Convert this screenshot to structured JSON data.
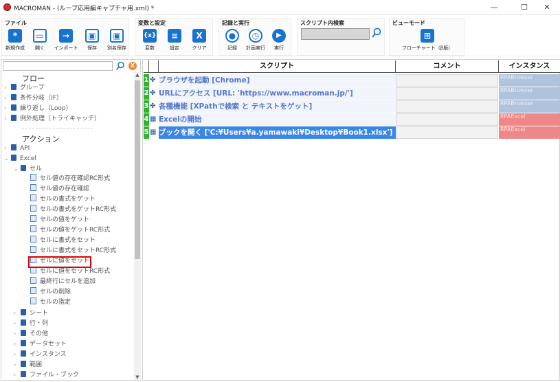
{
  "window": {
    "title": "MACROMAN - (ループ応用編キャプチャ用.xml) *",
    "minimize": "—",
    "maximize": "☐",
    "close": "✕"
  },
  "ribbon": {
    "file": {
      "title": "ファイル",
      "buttons": [
        {
          "label": "新規作成",
          "glyph": "*"
        },
        {
          "label": "開く",
          "glyph": "▭"
        },
        {
          "label": "インポート",
          "glyph": "→"
        },
        {
          "label": "保存",
          "glyph": "▣"
        },
        {
          "label": "別名保存",
          "glyph": "▣"
        }
      ]
    },
    "vars": {
      "title": "変数と設定",
      "buttons": [
        {
          "label": "変数",
          "glyph": "{x}"
        },
        {
          "label": "設定",
          "glyph": "≡"
        },
        {
          "label": "クリア",
          "glyph": "X"
        }
      ]
    },
    "record": {
      "title": "記録と実行",
      "buttons": [
        {
          "label": "記録",
          "glyph": "●"
        },
        {
          "label": "計画実行",
          "glyph": "◷"
        },
        {
          "label": "実行",
          "glyph": "▶"
        }
      ]
    },
    "search": {
      "title": "スクリプト内検索",
      "value": ""
    },
    "view": {
      "title": "ビューモード",
      "buttons": [
        {
          "label": "フローチャート（β版）",
          "glyph": "⊞"
        }
      ]
    }
  },
  "tree": {
    "search_value": "",
    "clear_glyph": "X",
    "flow_title": "フロー",
    "flow_items": [
      "グループ",
      "条件分岐（IF）",
      "繰り返し（Loop）",
      "例外処理（トライキャッチ）"
    ],
    "action_title": "アクション",
    "api": "API",
    "excel": "Excel",
    "cell": "セル",
    "cell_items": [
      "セル値の存在確認RC形式",
      "セル値の存在確認",
      "セルの書式をゲット",
      "セルの書式をゲットRC形式",
      "セルの値をゲット",
      "セルの値をゲットRC形式",
      "セルに書式をセット",
      "セルに書式をセットRC形式",
      "セルに値をセット",
      "セルに値をセットRC形式",
      "最終行にセルを追加",
      "セルの削除",
      "セルの指定"
    ],
    "other_items": [
      "シート",
      "行・列",
      "その他",
      "データセット",
      "インスタンス",
      "範囲",
      "ファイル・ブック"
    ]
  },
  "grid": {
    "headers": {
      "script": "スクリプト",
      "comment": "コメント",
      "instance": "インスタンス"
    },
    "rows": [
      {
        "num": "1",
        "icon": "✤",
        "text": "ブラウザを起動 [Chrome]",
        "comment": "",
        "instance": "RPABrowser",
        "kind": "browser"
      },
      {
        "num": "2",
        "icon": "✤",
        "text": "URLにアクセス [URL: 'https://www.macroman.jp/']",
        "comment": "",
        "instance": "RPABrowser",
        "kind": "browser"
      },
      {
        "num": "3",
        "icon": "✤",
        "text": "各種機能 [XPathで検索 と テキストをゲット]",
        "comment": "",
        "instance": "RPABrowser",
        "kind": "browser"
      },
      {
        "num": "4",
        "icon": "▦",
        "text": "Excelの開始",
        "comment": "",
        "instance": "RPAExcel",
        "kind": "excel"
      },
      {
        "num": "5",
        "icon": "▦",
        "text": "ブックを開く ['C:¥Users¥a.yamawaki¥Desktop¥Book1.xlsx']",
        "comment": "",
        "instance": "RPAExcel",
        "kind": "excel"
      }
    ]
  },
  "colors": {
    "accent": "#1873cf",
    "highlight": "#e00000",
    "browser": "#b0c3dc",
    "excel": "#ee8888",
    "rownum": "#2db52d",
    "selected": "#3a86e6"
  }
}
